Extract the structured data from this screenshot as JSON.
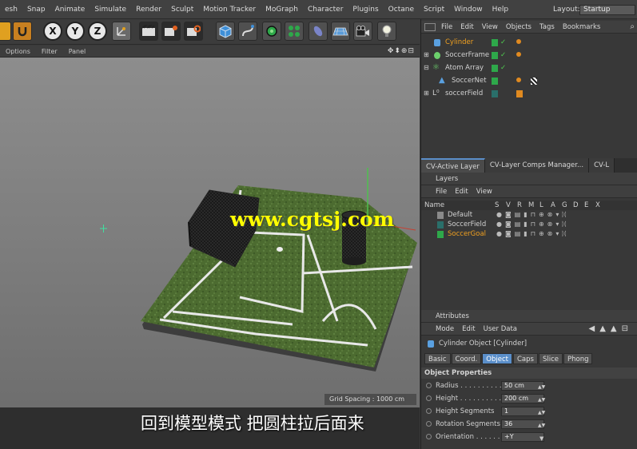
{
  "menubar": {
    "items": [
      "esh",
      "Snap",
      "Animate",
      "Simulate",
      "Render",
      "Sculpt",
      "Motion Tracker",
      "MoGraph",
      "Character",
      "Plugins",
      "Octane",
      "Script",
      "Window",
      "Help"
    ],
    "layout_label": "Layout:",
    "layout_value": "Startup"
  },
  "toolbar": {
    "x": "X",
    "y": "Y",
    "z": "Z"
  },
  "viewport": {
    "menu": [
      "Options",
      "Filter",
      "Panel"
    ],
    "nav_icons": "✥⬍⊕⊟",
    "grid_spacing": "Grid Spacing : 1000 cm",
    "watermark": "www.cgtsj.com"
  },
  "subtitle": "回到模型模式 把圆柱拉后面来",
  "objects": {
    "menu": [
      "File",
      "Edit",
      "View",
      "Objects",
      "Tags",
      "Bookmarks"
    ],
    "rows": [
      {
        "name": "Cylinder",
        "selected": true
      },
      {
        "name": "SoccerFrame",
        "selected": false
      },
      {
        "name": "Atom Array",
        "selected": false
      },
      {
        "name": "SoccerNet",
        "selected": false
      },
      {
        "name": "soccerField",
        "selected": false
      }
    ]
  },
  "tabs": [
    "CV-Active Layer",
    "CV-Layer Comps Manager...",
    "CV-L"
  ],
  "layers": {
    "title": "Layers",
    "menu": [
      "File",
      "Edit",
      "View"
    ],
    "name_col": "Name",
    "cols": [
      "S",
      "V",
      "R",
      "M",
      "L",
      "A",
      "G",
      "D",
      "E",
      "X"
    ],
    "rows": [
      {
        "name": "Default",
        "color": "#8a8a8a"
      },
      {
        "name": "SoccerField",
        "color": "#2a6f6a"
      },
      {
        "name": "SoccerGoal",
        "color": "#2ea84a"
      }
    ]
  },
  "attributes": {
    "title": "Attributes",
    "menu": [
      "Mode",
      "Edit",
      "User Data"
    ],
    "object_title": "Cylinder Object [Cylinder]",
    "tabs": [
      "Basic",
      "Coord.",
      "Object",
      "Caps",
      "Slice",
      "Phong"
    ],
    "active_tab": "Object",
    "section": "Object Properties",
    "props": [
      {
        "label": "Radius . . . . . . . . . .",
        "value": "50 cm"
      },
      {
        "label": "Height . . . . . . . . . .",
        "value": "200 cm"
      },
      {
        "label": "Height Segments",
        "value": "1"
      },
      {
        "label": "Rotation Segments",
        "value": "36"
      },
      {
        "label": "Orientation . . . . . .",
        "value": "+Y"
      }
    ]
  },
  "colors": {
    "accent": "#5a8ec9",
    "selected_text": "#f0a020",
    "field_green": "#4a6b2f"
  }
}
